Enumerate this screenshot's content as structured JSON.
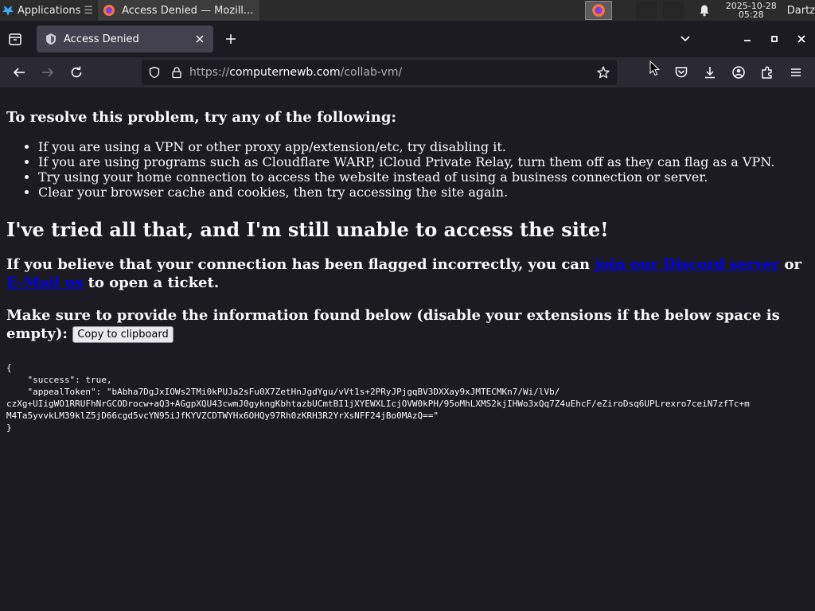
{
  "panel": {
    "applications_label": "Applications",
    "window_title": "Access Denied — Mozill...",
    "date": "2025-10-28",
    "time": "05:28",
    "user": "Dartz"
  },
  "tabs": [
    {
      "title": "Access Denied"
    }
  ],
  "url": {
    "scheme": "https://",
    "host": "computernewb.com",
    "path": "/collab-vm/"
  },
  "page": {
    "resolve_heading": "To resolve this problem, try any of the following:",
    "fixes": [
      "If you are using a VPN or other proxy app/extension/etc, try disabling it.",
      "If you are using programs such as Cloudflare WARP, iCloud Private Relay, turn them off as they can flag as a VPN.",
      "Try using your home connection to access the website instead of using a business connection or server.",
      "Clear your browser cache and cookies, then try accessing the site again."
    ],
    "still_heading": "I've tried all that, and I'm still unable to access the site!",
    "contact_prefix": "If you believe that your connection has been flagged incorrectly, you can",
    "discord_link": "join our Discord server",
    "contact_or": "or",
    "email_link": "E-Mail us",
    "contact_suffix": "to open a ticket.",
    "info_text": "Make sure to provide the information found below (disable your extensions if the below space is empty):",
    "copy_button": "Copy to clipboard",
    "json_output": "{\n    \"success\": true,\n    \"appealToken\": \"bAbha7DgJxIOWs2TMi0kPUJa2sFu0X7ZetHnJgdYgu/vVt1s+2PRyJPjgqBV3DXXay9xJMTECMKn7/Wi/lVb/\nczXg+UIigWO1RRUFhNrGCODrocw+aQ3+AGgpXQU43cwmJ0gykngKbhtazbUCmtBI1jXYEWXLIcjOVW0kPH/95oMhLXMS2kjIHWo3xQq7Z4uEhcF/eZiroDsq6UPLrexro7ceiN7zfTc+m\nM4Ta5yvvkLM39klZ5jD66cgd5vcYN95iJfKYVZCDTWYHx6OHQy97Rh0zKRH3R2YrXsNFF24jBo0MAzQ==\"\n}"
  }
}
